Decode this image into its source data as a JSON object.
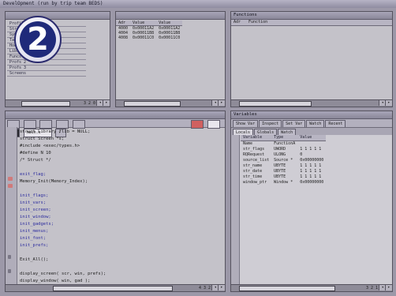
{
  "window": {
    "title": "DevelOpment (run by trip team BEDS)"
  },
  "logo": {
    "text": "2"
  },
  "left_top": {
    "items": [
      "Profile",
      "Strings",
      "Symbols",
      "Tasks",
      "Hooks",
      "Libs",
      "Funcs",
      "Profs 2",
      "Profs 3",
      "Screens"
    ],
    "scroll_label": "3 2 0"
  },
  "memory": {
    "columns": [
      "Adr",
      "Value",
      "Value"
    ],
    "rows": [
      [
        "4000",
        "0x00011A2",
        "0x00011A2"
      ],
      [
        "4004",
        "0x00011B8",
        "0x00011B8"
      ],
      [
        "4008",
        "0x00011C0",
        "0x00011C0"
      ]
    ]
  },
  "functions": {
    "title": "Functions",
    "columns": [
      "Adr",
      "Function"
    ]
  },
  "editor": {
    "toolbar_field": "main.c",
    "lines": [
      "  struct Library *lib = NULL;",
      "  struct Screen *s;",
      "  #include <exec/types.h>",
      "  #define N 10",
      "  /* Struct */",
      "",
      "  exit_flag;",
      "  Memory_Init(Memory_Index);",
      "",
      "  init_flags;",
      "  init_vars;",
      "  init_screen;",
      "  init_window;",
      "  init_gadgets;",
      "  init_menus;",
      "  init_font;",
      "  init_prefs;",
      "",
      "  Exit_All();",
      "",
      "  display_screen( scr, win, prefs);",
      "  display_window( win, gad );"
    ],
    "scroll_label": "4 3 2"
  },
  "vars": {
    "title": "Variables",
    "buttons": [
      "Show Var",
      "Inspect",
      "Set Var",
      "Watch",
      "Recent"
    ],
    "tabs": [
      "Locals",
      "Globals",
      "Watch"
    ],
    "columns": [
      "Variable",
      "Type",
      "Value"
    ],
    "rows": [
      [
        "Name",
        "FunctionA",
        ""
      ],
      [
        "str_flags",
        "UWORD",
        "1 1 1 1 1"
      ],
      [
        "RQRequest",
        "ULONG",
        "0"
      ],
      [
        "source_list",
        "Source *",
        "0x00000000"
      ],
      [
        "str_name",
        "UBYTE",
        "1 1 1 1 1"
      ],
      [
        "str_date",
        "UBYTE",
        "1 1 1 1 1"
      ],
      [
        "str_time",
        "UBYTE",
        "1 1 1 1 1"
      ],
      [
        "window_ptr",
        "Window *",
        "0x00000000"
      ]
    ],
    "scroll_label": "3 2 1"
  },
  "colors": {
    "background": "#9c98a8",
    "pane": "#c4c2c9",
    "logo": "#1f2a7a",
    "keyword": "#2b2b9e"
  }
}
